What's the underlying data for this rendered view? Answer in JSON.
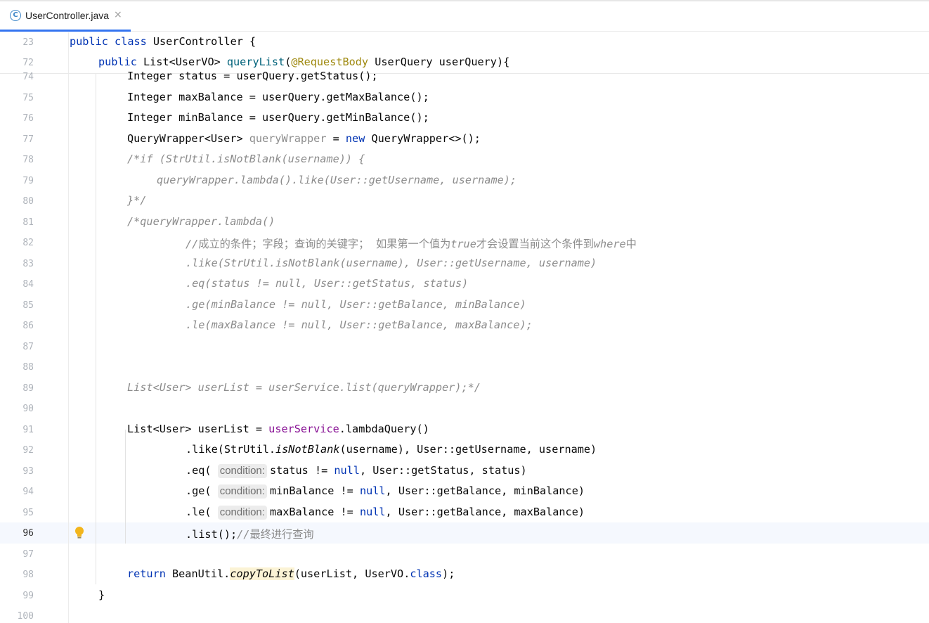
{
  "tab": {
    "icon": "class-c-icon",
    "icon_glyph": "C",
    "label": "UserController.java",
    "close": "×"
  },
  "lines": [
    {
      "n": "23",
      "parts": [
        [
          "kw",
          "public"
        ],
        [
          "",
          " "
        ],
        [
          "kw",
          "class"
        ],
        [
          "",
          " UserController {"
        ]
      ]
    },
    {
      "n": "72",
      "parts": [
        [
          "kw",
          "public"
        ],
        [
          "",
          " List<UserVO> "
        ],
        [
          "m",
          "queryList"
        ],
        [
          "",
          "("
        ],
        [
          "ann",
          "@RequestBody"
        ],
        [
          "",
          " UserQuery userQuery){"
        ]
      ]
    },
    {
      "n": "74",
      "parts": [
        [
          "",
          "Integer status = userQuery.getStatus();"
        ]
      ]
    },
    {
      "n": "75",
      "parts": [
        [
          "",
          "Integer maxBalance = userQuery.getMaxBalance();"
        ]
      ]
    },
    {
      "n": "76",
      "parts": [
        [
          "",
          "Integer minBalance = userQuery.getMinBalance();"
        ]
      ]
    },
    {
      "n": "77",
      "parts": [
        [
          "",
          "QueryWrapper<User> "
        ],
        [
          "gray",
          "queryWrapper"
        ],
        [
          "",
          " = "
        ],
        [
          "kw",
          "new"
        ],
        [
          "",
          " QueryWrapper<>();"
        ]
      ]
    },
    {
      "n": "78",
      "parts": [
        [
          "cmt",
          "/*if (StrUtil.isNotBlank(username)) {"
        ]
      ]
    },
    {
      "n": "79",
      "parts": [
        [
          "cmt",
          "queryWrapper.lambda().like(User::getUsername, username);"
        ]
      ]
    },
    {
      "n": "80",
      "parts": [
        [
          "cmt",
          "}*/"
        ]
      ]
    },
    {
      "n": "81",
      "parts": [
        [
          "cmt",
          "/*queryWrapper.lambda()"
        ]
      ]
    },
    {
      "n": "82",
      "parts": [
        [
          "cmt",
          "//"
        ],
        [
          "cmt cjk",
          "成立的条件；字段；查询的关键字；  如果第一个值为"
        ],
        [
          "cmt",
          "true"
        ],
        [
          "cmt cjk",
          "才会设置当前这个条件到"
        ],
        [
          "cmt",
          "where"
        ],
        [
          "cmt cjk",
          "中"
        ]
      ]
    },
    {
      "n": "83",
      "parts": [
        [
          "cmt",
          ".like(StrUtil.isNotBlank(username), User::getUsername, username)"
        ]
      ]
    },
    {
      "n": "84",
      "parts": [
        [
          "cmt",
          ".eq(status != null, User::getStatus, status)"
        ]
      ]
    },
    {
      "n": "85",
      "parts": [
        [
          "cmt",
          ".ge(minBalance != null, User::getBalance, minBalance)"
        ]
      ]
    },
    {
      "n": "86",
      "parts": [
        [
          "cmt",
          ".le(maxBalance != null, User::getBalance, maxBalance);"
        ]
      ]
    },
    {
      "n": "87",
      "parts": []
    },
    {
      "n": "88",
      "parts": []
    },
    {
      "n": "89",
      "parts": [
        [
          "cmt",
          "List<User> userList = userService.list(queryWrapper);*/"
        ]
      ]
    },
    {
      "n": "90",
      "parts": []
    },
    {
      "n": "91",
      "parts": [
        [
          "",
          "List<User> userList = "
        ],
        [
          "fld",
          "userService"
        ],
        [
          "",
          ".lambdaQuery()"
        ]
      ]
    },
    {
      "n": "92",
      "parts": [
        [
          "",
          ".like(StrUtil."
        ],
        [
          "ital",
          "isNotBlank"
        ],
        [
          "",
          "(username), User::getUsername, username)"
        ]
      ]
    },
    {
      "n": "93",
      "parts": [
        [
          "",
          ".eq( "
        ],
        [
          "hint",
          "condition:"
        ],
        [
          "",
          "status != "
        ],
        [
          "kw",
          "null"
        ],
        [
          "",
          ", User::getStatus, status)"
        ]
      ]
    },
    {
      "n": "94",
      "parts": [
        [
          "",
          ".ge( "
        ],
        [
          "hint",
          "condition:"
        ],
        [
          "",
          "minBalance != "
        ],
        [
          "kw",
          "null"
        ],
        [
          "",
          ", User::getBalance, minBalance)"
        ]
      ]
    },
    {
      "n": "95",
      "parts": [
        [
          "",
          ".le( "
        ],
        [
          "hint",
          "condition:"
        ],
        [
          "",
          "maxBalance != "
        ],
        [
          "kw",
          "null"
        ],
        [
          "",
          ", User::getBalance, maxBalance)"
        ]
      ]
    },
    {
      "n": "96",
      "parts": [
        [
          "",
          ".list();"
        ],
        [
          "cmt",
          "//"
        ],
        [
          "cmt cjk",
          "最终进行查询"
        ]
      ]
    },
    {
      "n": "97",
      "parts": []
    },
    {
      "n": "98",
      "parts": [
        [
          "kw",
          "return"
        ],
        [
          "",
          " BeanUtil."
        ],
        [
          "ital hl-method",
          "copyToList"
        ],
        [
          "",
          "(userList, UserVO."
        ],
        [
          "kw",
          "class"
        ],
        [
          "",
          ");"
        ]
      ]
    },
    {
      "n": "99",
      "parts": [
        [
          "",
          "}"
        ]
      ]
    },
    {
      "n": "100",
      "parts": []
    }
  ],
  "current_line": "96",
  "intention_icon": "lightbulb-icon",
  "colors": {
    "keyword": "#0033b3",
    "method": "#00627a",
    "annotation": "#9e880d",
    "comment": "#8c8c8c",
    "field": "#871094",
    "tab_accent": "#3474f0"
  }
}
